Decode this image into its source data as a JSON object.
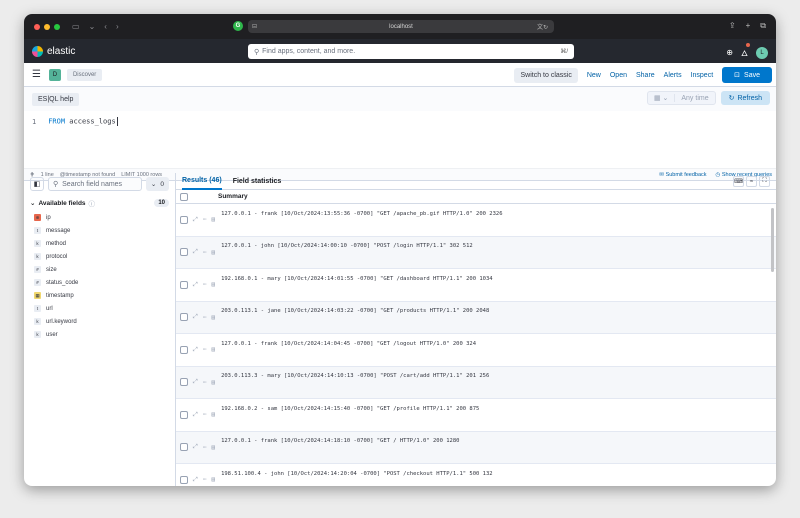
{
  "browser": {
    "url": "localhost"
  },
  "header": {
    "brand": "elastic",
    "search_placeholder": "Find apps, content, and more.",
    "search_shortcut": "⌘/",
    "avatar_initial": "L"
  },
  "appbar": {
    "space_badge": "D",
    "breadcrumb": "Discover",
    "switch_label": "Switch to classic",
    "nav": [
      "New",
      "Open",
      "Share",
      "Alerts",
      "Inspect"
    ],
    "save_label": "Save"
  },
  "query": {
    "help_label": "ES|QL help",
    "date_label": "Any time",
    "refresh_label": "Refresh",
    "line_number": "1",
    "keyword": "FROM",
    "source": "access_logs"
  },
  "editor_status": {
    "lines": "1 line",
    "timestamp_note": "@timestamp not found",
    "limit": "LIMIT 1000 rows",
    "feedback": "Submit feedback",
    "recent": "Show recent queries"
  },
  "sidebar": {
    "search_placeholder": "Search field names",
    "filter_count": "0",
    "available_label": "Available fields",
    "available_count": "10",
    "fields": [
      {
        "name": "ip",
        "type": "ip",
        "color": "#e7664c",
        "glyph": "⊕"
      },
      {
        "name": "message",
        "type": "text",
        "color": "#e9edf3",
        "glyph": "t"
      },
      {
        "name": "method",
        "type": "keyword",
        "color": "#e9edf3",
        "glyph": "k"
      },
      {
        "name": "protocol",
        "type": "keyword",
        "color": "#e9edf3",
        "glyph": "k"
      },
      {
        "name": "size",
        "type": "number",
        "color": "#e9edf3",
        "glyph": "#"
      },
      {
        "name": "status_code",
        "type": "number",
        "color": "#e9edf3",
        "glyph": "#"
      },
      {
        "name": "timestamp",
        "type": "date",
        "color": "#f1d86f",
        "glyph": "▦"
      },
      {
        "name": "url",
        "type": "text",
        "color": "#e9edf3",
        "glyph": "t"
      },
      {
        "name": "url.keyword",
        "type": "keyword",
        "color": "#e9edf3",
        "glyph": "k"
      },
      {
        "name": "user",
        "type": "keyword",
        "color": "#e9edf3",
        "glyph": "k"
      }
    ]
  },
  "results": {
    "tab_results": "Results (46)",
    "tab_stats": "Field statistics",
    "column_summary": "Summary",
    "rows": [
      "127.0.0.1 - frank [10/Oct/2024:13:55:36 -0700] \"GET /apache_pb.gif HTTP/1.0\" 200 2326",
      "127.0.0.1 - john [10/Oct/2024:14:00:10 -0700] \"POST /login HTTP/1.1\" 302 512",
      "192.168.0.1 - mary [10/Oct/2024:14:01:55 -0700] \"GET /dashboard HTTP/1.1\" 200 1034",
      "203.0.113.1 - jane [10/Oct/2024:14:03:22 -0700] \"GET /products HTTP/1.1\" 200 2048",
      "127.0.0.1 - frank [10/Oct/2024:14:04:45 -0700] \"GET /logout HTTP/1.0\" 200 324",
      "203.0.113.3 - mary [10/Oct/2024:14:10:13 -0700] \"POST /cart/add HTTP/1.1\" 201 256",
      "192.168.0.2 - sam [10/Oct/2024:14:15:40 -0700] \"GET /profile HTTP/1.1\" 200 875",
      "127.0.0.1 - frank [10/Oct/2024:14:18:10 -0700] \"GET / HTTP/1.0\" 200 1280",
      "198.51.100.4 - john [10/Oct/2024:14:20:04 -0700] \"POST /checkout HTTP/1.1\" 500 132"
    ]
  },
  "colors": {
    "accent": "#0077cc",
    "header_bg": "#25282f",
    "chrome_bg": "#1f1f22"
  }
}
